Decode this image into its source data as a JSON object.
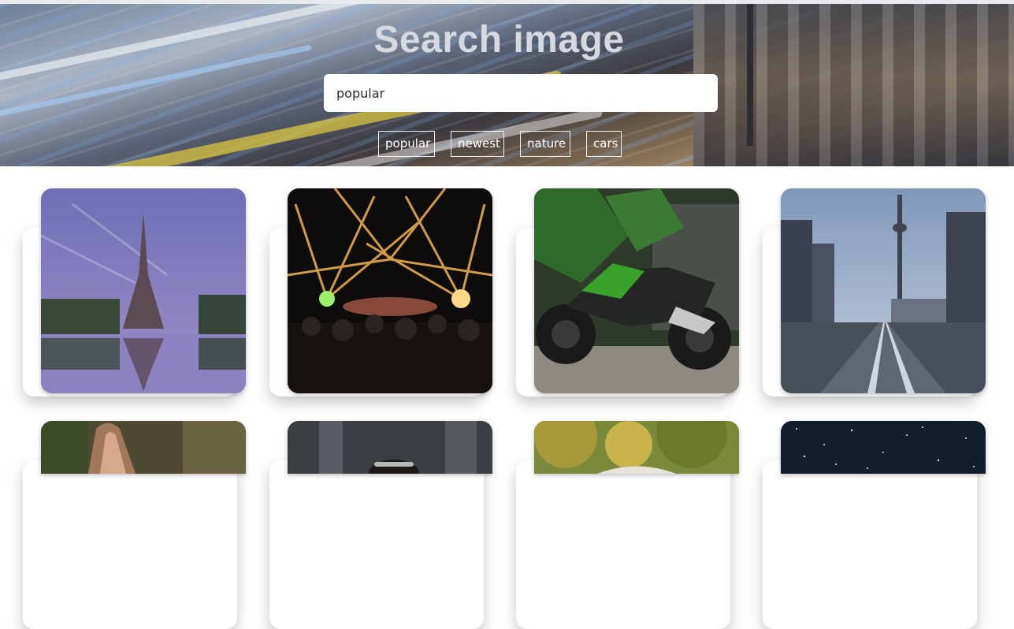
{
  "hero": {
    "title": "Search image",
    "search": {
      "value": "popular",
      "placeholder": ""
    },
    "chips": [
      "popular",
      "newest",
      "nature",
      "cars"
    ]
  },
  "gallery": {
    "items": [
      {
        "subject": "eiffel-tower-reflection"
      },
      {
        "subject": "concert-stage-lights"
      },
      {
        "subject": "green-motorcycle"
      },
      {
        "subject": "city-skyline-rail-tracks"
      },
      {
        "subject": "rabbit-ears"
      },
      {
        "subject": "person-in-street"
      },
      {
        "subject": "car-under-trees"
      },
      {
        "subject": "starry-night-sky"
      }
    ]
  },
  "colors": {
    "chip_border": "#f1f1f1",
    "title": "#d6d9e0",
    "card_bg": "#ffffff"
  }
}
